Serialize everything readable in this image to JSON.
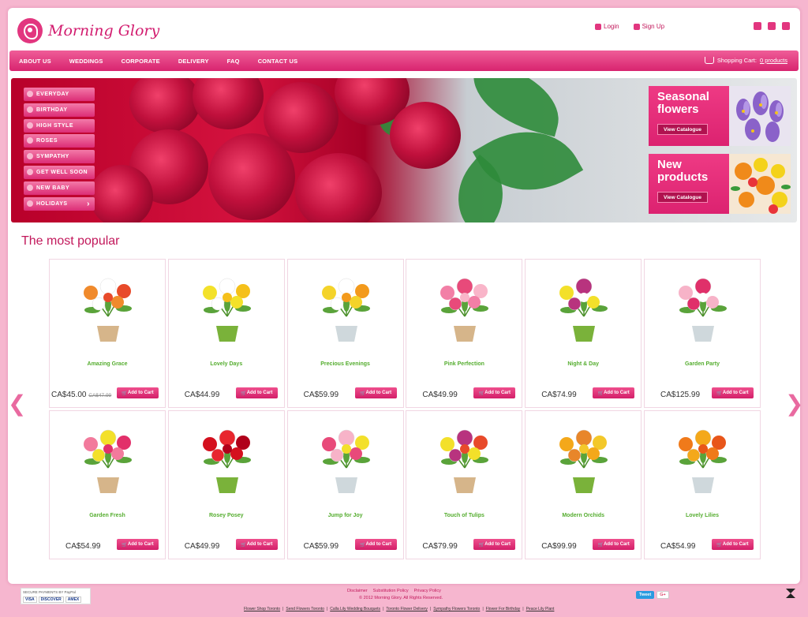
{
  "brand": {
    "name": "Morning Glory"
  },
  "header": {
    "login": "Login",
    "signup": "Sign Up"
  },
  "nav": {
    "items": [
      "About Us",
      "Weddings",
      "Corporate",
      "Delivery",
      "FAQ",
      "Contact Us"
    ],
    "cart_label": "Shopping Cart:",
    "cart_link": "0 products"
  },
  "categories": [
    "EVERYDAY",
    "BIRTHDAY",
    "HIGH STYLE",
    "ROSES",
    "SYMPATHY",
    "GET WELL SOON",
    "NEW BABY",
    "HOLIDAYS"
  ],
  "promos": [
    {
      "title": "Seasonal flowers",
      "button": "View Catalogue"
    },
    {
      "title": "New products",
      "button": "View Catalogue"
    }
  ],
  "section_title": "The most popular",
  "add_to_cart": "Add to Cart",
  "nav_arrows": {
    "prev": "❮",
    "next": "❯"
  },
  "products": [
    {
      "name": "Amazing Grace",
      "price": "CA$45.00",
      "old_price": "CA$47.99",
      "colors": [
        "#f08a2c",
        "#ffffff",
        "#e84a2a"
      ]
    },
    {
      "name": "Lovely Days",
      "price": "CA$44.99",
      "colors": [
        "#f3e12a",
        "#ffffff",
        "#f5c01a"
      ]
    },
    {
      "name": "Precious Evenings",
      "price": "CA$59.99",
      "colors": [
        "#f4d32a",
        "#ffffff",
        "#f39a1c"
      ]
    },
    {
      "name": "Pink Perfection",
      "price": "CA$49.99",
      "colors": [
        "#f27fa6",
        "#e84a7a",
        "#f9b5c9"
      ]
    },
    {
      "name": "Night & Day",
      "price": "CA$74.99",
      "colors": [
        "#f3e02a",
        "#b8337e",
        "#ffffff"
      ]
    },
    {
      "name": "Garden Party",
      "price": "CA$125.99",
      "colors": [
        "#f7b3c8",
        "#e0306a",
        "#ffffff"
      ]
    },
    {
      "name": "Garden Fresh",
      "price": "CA$54.99",
      "colors": [
        "#f27a9c",
        "#f3e02a",
        "#e2306a"
      ]
    },
    {
      "name": "Rosey Posey",
      "price": "CA$49.99",
      "colors": [
        "#d4101e",
        "#e8262e",
        "#b0001a"
      ]
    },
    {
      "name": "Jump for Joy",
      "price": "CA$59.99",
      "colors": [
        "#e84a7a",
        "#f7b3c8",
        "#f3e02a"
      ]
    },
    {
      "name": "Touch of Tulips",
      "price": "CA$79.99",
      "colors": [
        "#f3e02a",
        "#b8337e",
        "#e84a2a"
      ]
    },
    {
      "name": "Modern Orchids",
      "price": "CA$99.99",
      "colors": [
        "#f4a81a",
        "#e8862a",
        "#f3c82a"
      ]
    },
    {
      "name": "Lovely Lilies",
      "price": "CA$54.99",
      "colors": [
        "#f07a1a",
        "#f4a81a",
        "#e8561a"
      ]
    }
  ],
  "footer": {
    "paypal": "SECURE PAYMENTS BY PayPal",
    "cards": [
      "VISA",
      "DISCOVER",
      "AMEX"
    ],
    "links": [
      "Disclaimer",
      "Substitution Policy",
      "Privacy Policy"
    ],
    "copyright": "© 2012 Morning Glory. All Rights Reserved.",
    "bottom_links": [
      "Flower Shop Toronto",
      "Send Flowers Toronto",
      "Calla Lily Wedding Bouquets",
      "Toronto Flower Delivery",
      "Sympathy Flowers Toronto",
      "Flower For Birthday",
      "Peace Lily Plant"
    ],
    "tweet": "Tweet",
    "gplus": "G+"
  }
}
